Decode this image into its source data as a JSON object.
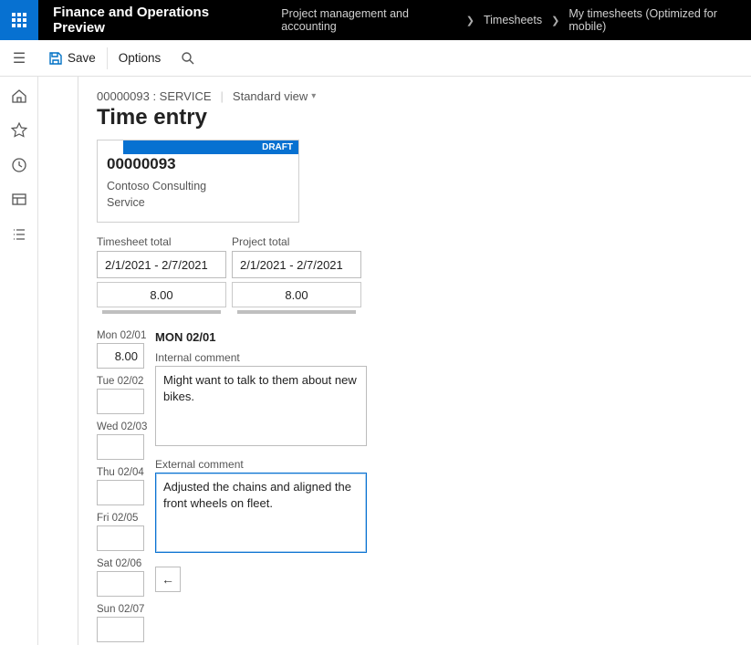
{
  "topbar": {
    "brand": "Finance and Operations Preview",
    "crumbs": {
      "c1": "Project management and accounting",
      "c2": "Timesheets",
      "c3": "My timesheets (Optimized for mobile)"
    }
  },
  "cmd": {
    "save": "Save",
    "options": "Options"
  },
  "record": {
    "id_line": "00000093 : SERVICE",
    "view_label": "Standard view",
    "title": "Time entry",
    "card_id": "00000093",
    "customer": "Contoso Consulting",
    "service": "Service",
    "draft_badge": "DRAFT"
  },
  "totals": {
    "ts_label": "Timesheet total",
    "ts_range": "2/1/2021 - 2/7/2021",
    "ts_value": "8.00",
    "pr_label": "Project total",
    "pr_range": "2/1/2021 - 2/7/2021",
    "pr_value": "8.00"
  },
  "days": {
    "mon": {
      "label": "Mon 02/01",
      "value": "8.00"
    },
    "tue": {
      "label": "Tue 02/02",
      "value": ""
    },
    "wed": {
      "label": "Wed 02/03",
      "value": ""
    },
    "thu": {
      "label": "Thu 02/04",
      "value": ""
    },
    "fri": {
      "label": "Fri 02/05",
      "value": ""
    },
    "sat": {
      "label": "Sat 02/06",
      "value": ""
    },
    "sun": {
      "label": "Sun 02/07",
      "value": ""
    }
  },
  "detail": {
    "selected_header": "MON 02/01",
    "internal_label": "Internal comment",
    "internal_value": "Might want to talk to them about new bikes.",
    "external_label": "External comment",
    "external_value": "Adjusted the chains and aligned the front wheels on fleet."
  }
}
